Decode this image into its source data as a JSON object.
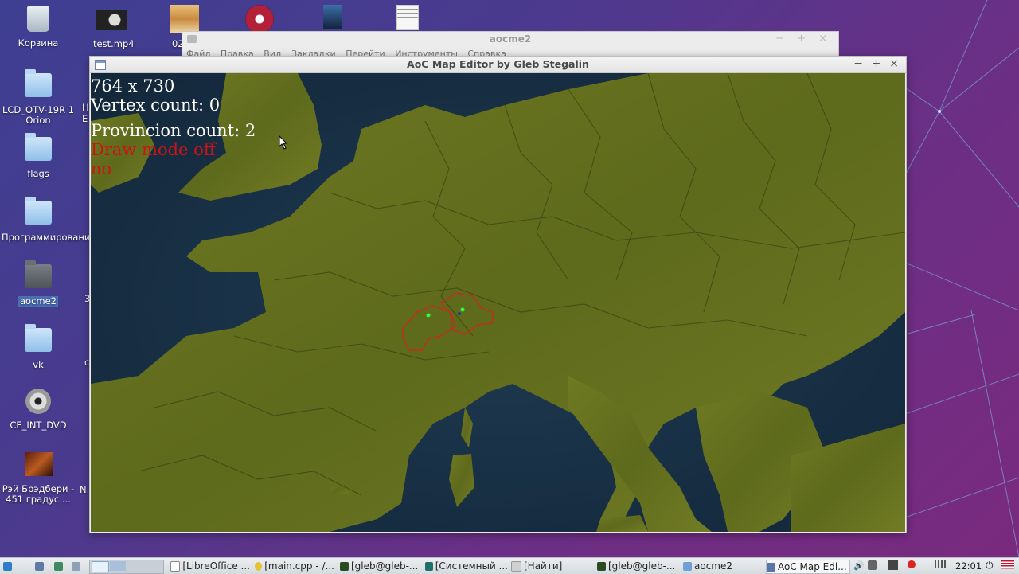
{
  "desktop": {
    "left_icons": [
      {
        "name": "Корзина",
        "type": "trash"
      },
      {
        "name": "LCD_OTV-19R 1 Orion",
        "type": "folder"
      },
      {
        "name": "flags",
        "type": "folder"
      },
      {
        "name": "Программирование",
        "type": "folder"
      },
      {
        "name": "aocme2",
        "type": "folder-dark"
      },
      {
        "name": "vk",
        "type": "folder"
      },
      {
        "name": "CE_INT_DVD",
        "type": "dvd"
      },
      {
        "name": "Рэй Брэдбери - 451 градус ...",
        "type": "video-thumb"
      }
    ],
    "top_labels": {
      "test_mp4": "test.mp4",
      "partial_02": "02"
    },
    "partial_labels": {
      "h": "H",
      "e": "E",
      "n": "N.",
      "three": "3",
      "c": "c"
    }
  },
  "bg_window": {
    "title": "aocme2",
    "menu": [
      "Файл",
      "Правка",
      "Вид",
      "Закладки",
      "Перейти",
      "Инструменты",
      "Справка"
    ]
  },
  "main_window": {
    "title": "AoC Map Editor by Gleb Stegalin",
    "controls": {
      "minimize": "−",
      "maximize": "+",
      "close": "×"
    },
    "overlay": {
      "dimensions": "764 x 730",
      "vertex_count": "Vertex count: 0",
      "province_count": "Provincion count: 2",
      "draw_mode": "Draw mode off",
      "status": "no"
    },
    "colors": {
      "province_outline": "#c0301c",
      "vertex_point": "#2fff3a",
      "overlay_white": "#ffffff",
      "overlay_red": "#cc1414"
    }
  },
  "taskbar": {
    "items": [
      {
        "label": "[LibreOffice ...",
        "icon": "document-icon"
      },
      {
        "label": "[main.cpp - /...",
        "icon": "editor-icon"
      },
      {
        "label": "[gleb@gleb-...",
        "icon": "terminal-icon"
      },
      {
        "label": "[Системный ...",
        "icon": "system-monitor-icon"
      },
      {
        "label": "[Найти]",
        "icon": "search-icon"
      },
      {
        "label": "[gleb@gleb-...",
        "icon": "terminal-icon"
      },
      {
        "label": "aocme2",
        "icon": "folder-icon"
      },
      {
        "label": "AoC Map Edi...",
        "icon": "window-icon"
      }
    ],
    "clock": "22:01"
  }
}
